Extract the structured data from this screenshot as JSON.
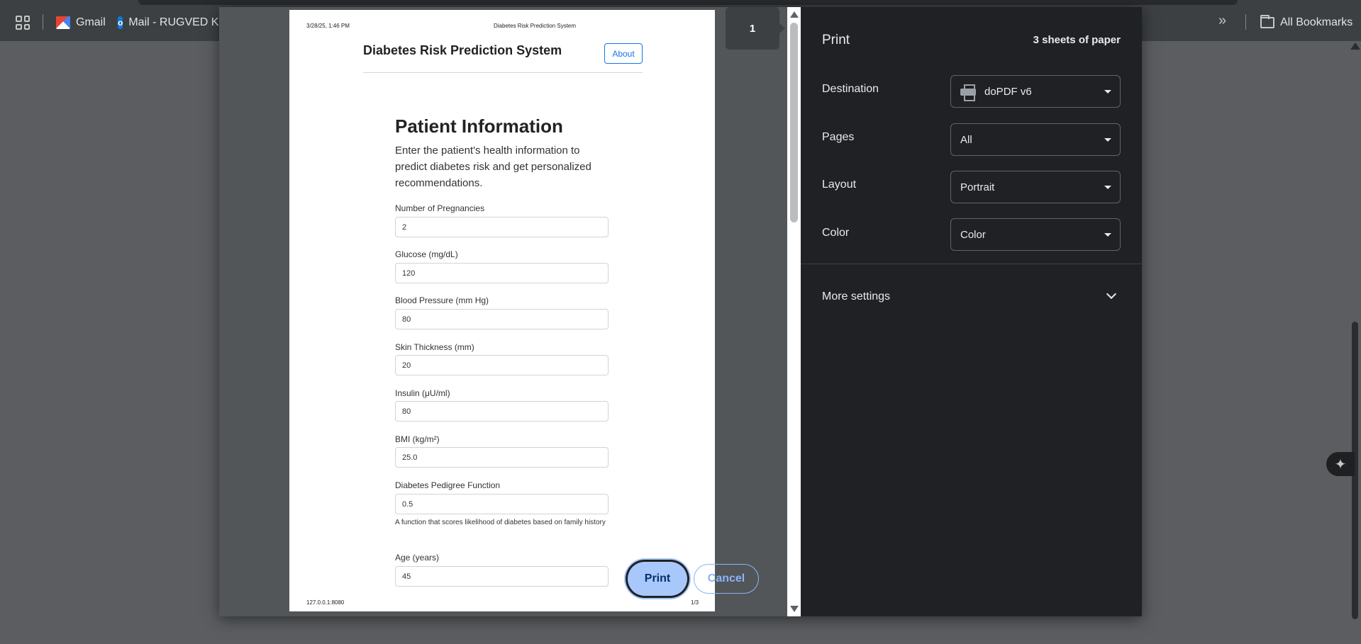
{
  "bookmarks_bar": {
    "items": [
      {
        "label": "Gmail",
        "icon": "gmail-icon"
      },
      {
        "label": "Mail - RUGVED KI",
        "icon": "outlook-icon"
      }
    ],
    "all_bookmarks_label": "All Bookmarks",
    "overflow_icon": "»"
  },
  "preview": {
    "page_number": "1",
    "document": {
      "header_date": "3/28/25, 1:46 PM",
      "header_title": "Diabetes Risk Prediction System",
      "app_title": "Diabetes Risk Prediction System",
      "about_button": "About",
      "heading": "Patient Information",
      "intro": "Enter the patient's health information to predict diabetes risk and get personalized recommendations.",
      "fields": [
        {
          "label": "Number of Pregnancies",
          "value": "2"
        },
        {
          "label": "Glucose (mg/dL)",
          "value": "120"
        },
        {
          "label": "Blood Pressure (mm Hg)",
          "value": "80"
        },
        {
          "label": "Skin Thickness (mm)",
          "value": "20"
        },
        {
          "label": "Insulin (μU/ml)",
          "value": "80"
        },
        {
          "label": "BMI (kg/m²)",
          "value": "25.0"
        },
        {
          "label": "Diabetes Pedigree Function",
          "value": "0.5",
          "help": "A function that scores likelihood of diabetes based on family history"
        },
        {
          "label": "Age (years)",
          "value": "45"
        }
      ],
      "footer_url": "127.0.0.1:8080",
      "footer_page": "1/3"
    }
  },
  "settings": {
    "title": "Print",
    "sheets": "3 sheets of paper",
    "rows": [
      {
        "label": "Destination",
        "value": "doPDF v6"
      },
      {
        "label": "Pages",
        "value": "All"
      },
      {
        "label": "Layout",
        "value": "Portrait"
      },
      {
        "label": "Color",
        "value": "Color"
      }
    ],
    "more_settings": "More settings",
    "print_button": "Print",
    "cancel_button": "Cancel"
  },
  "colors": {
    "accent": "#a8c7fa",
    "link": "#8ab4f8",
    "dialog_bg": "#202124"
  }
}
